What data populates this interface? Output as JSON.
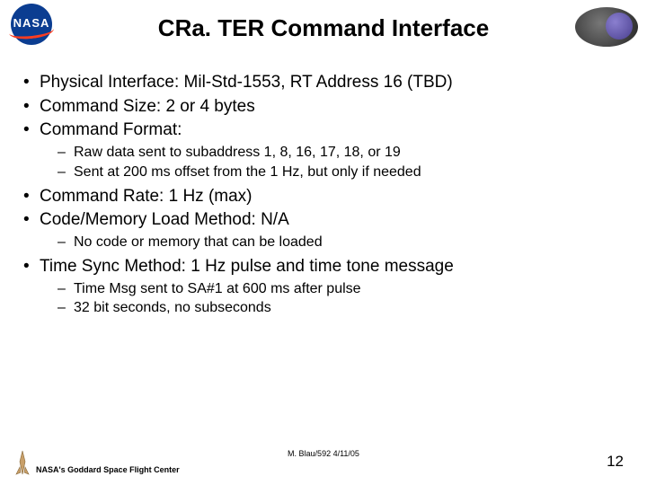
{
  "header": {
    "nasa_text": "NASA",
    "title": "CRa. TER Command Interface"
  },
  "bullets": [
    {
      "text": "Physical Interface: Mil-Std-1553, RT Address 16 (TBD)",
      "sub": []
    },
    {
      "text": "Command Size: 2 or 4 bytes",
      "sub": []
    },
    {
      "text": "Command Format:",
      "sub": [
        "Raw data sent to subaddress 1, 8, 16, 17, 18, or 19",
        "Sent at 200 ms offset from the 1 Hz, but only if needed"
      ]
    },
    {
      "text": "Command Rate: 1 Hz (max)",
      "sub": []
    },
    {
      "text": "Code/Memory Load Method: N/A",
      "sub": [
        "No code or memory that can be loaded"
      ]
    },
    {
      "text": "Time Sync Method: 1 Hz pulse and time tone message",
      "sub": [
        "Time Msg sent to SA#1 at 600 ms after pulse",
        "32 bit seconds, no subseconds"
      ]
    }
  ],
  "footer": {
    "center_label": "NASA's Goddard Space Flight Center",
    "credit": "M. Blau/592 4/11/05",
    "page": "12"
  }
}
